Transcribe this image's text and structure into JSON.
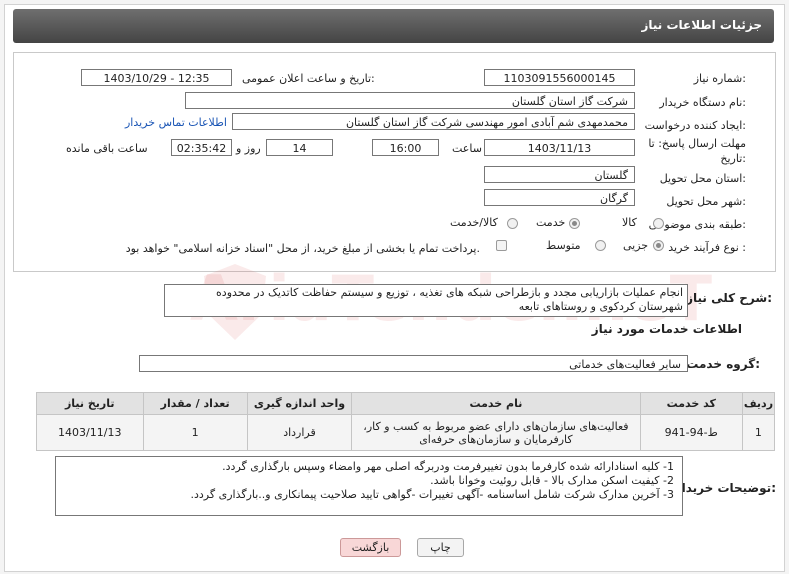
{
  "header": {
    "title": "جزئیات اطلاعات نیاز"
  },
  "form": {
    "need_number_label": "شماره نیاز:",
    "need_number": "1103091556000145",
    "announce_label": "تاریخ و ساعت اعلان عمومی:",
    "announce_value": "1403/10/29 - 12:35",
    "buyer_org_label": "نام دستگاه خریدار:",
    "buyer_org": "شرکت گاز استان گلستان",
    "creator_label": "ایجاد کننده درخواست:",
    "creator": "محمدمهدی شم آبادی امور مهندسی شرکت گاز استان گلستان",
    "contact_link": "اطلاعات تماس خریدار",
    "deadline_label_1": "مهلت ارسال پاسخ: تا",
    "deadline_label_2": "تاریخ:",
    "deadline_date": "1403/11/13",
    "time_label": "ساعت",
    "deadline_time": "16:00",
    "days_value": "14",
    "days_label": "روز و",
    "remaining_time": "02:35:42",
    "remaining_label": "ساعت باقی مانده",
    "province_label": "استان محل تحویل:",
    "province": "گلستان",
    "city_label": "شهر محل تحویل:",
    "city": "گرگان",
    "category_label": "طبقه بندی موضوعی:",
    "category_options": [
      "کالا",
      "خدمت",
      "کالا/خدمت"
    ],
    "category_selected": "خدمت",
    "process_label": "نوع فرآیند خرید :",
    "process_options": [
      "جزیی",
      "متوسط"
    ],
    "process_selected": "جزیی",
    "payment_note": "پرداخت تمام یا بخشی از مبلغ خرید، از محل \"اسناد خزانه اسلامی\" خواهد بود."
  },
  "description": {
    "label": "شرح کلی نیاز:",
    "text": "انجام عملیات بازاریابی مجدد و بازطراحی شبکه های تغذیه ، توزیع و سیستم حفاظت کاتدیک در محدوده شهرستان کردکوی و روستاهای تابعه"
  },
  "services": {
    "section_title": "اطلاعات خدمات مورد نیاز",
    "group_label": "گروه خدمت:",
    "group_value": "سایر فعالیت‌های خدماتی",
    "columns": [
      "ردیف",
      "کد خدمت",
      "نام خدمت",
      "واحد اندازه گیری",
      "تعداد / مقدار",
      "تاریخ نیاز"
    ],
    "rows": [
      [
        "1",
        "ط-94-941",
        "فعالیت‌های سازمان‌های دارای عضو مربوط به کسب و کار، کارفرمایان و سازمان‌های حرفه‌ای",
        "قرارداد",
        "1",
        "1403/11/13"
      ]
    ]
  },
  "buyer_notes": {
    "label": "توضیحات خریدار:",
    "lines": [
      "1-    کلیه اسنادارائه شده کارفرما بدون تغییرفرمت ودربرگه اصلی مهر وامضاء وسپس بارگذاری گردد.",
      "2-    کیفیت اسکن مدارک بالا - قابل روئیت وخوانا باشد.",
      "3-    آخرین مدارک شرکت شامل اساسنامه -آگهی تغییرات -گواهی تایید صلاحیت پیمانکاری و..بارگذاری گردد."
    ]
  },
  "buttons": {
    "print": "چاپ",
    "back": "بازگشت"
  },
  "watermark": "AriaTender.neT",
  "colors": {
    "title_bar": "#555555",
    "link": "#1a55b5",
    "back_button": "#f8d7d7"
  }
}
